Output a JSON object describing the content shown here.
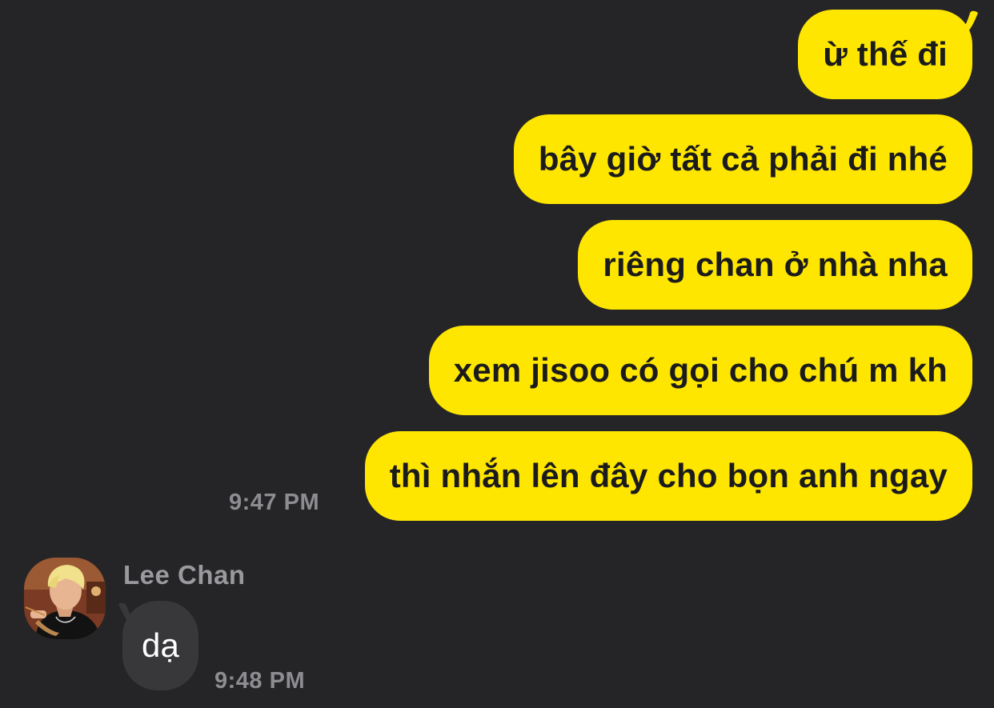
{
  "chat": {
    "outgoing": [
      {
        "text": "ừ thế đi"
      },
      {
        "text": "bây giờ tất cả phải đi nhé"
      },
      {
        "text": "riêng chan ở nhà nha"
      },
      {
        "text": "xem jisoo có gọi cho chú m kh"
      },
      {
        "text": "thì nhắn lên đây cho bọn anh ngay"
      }
    ],
    "outgoing_time": "9:47 PM",
    "incoming": {
      "sender": "Lee Chan",
      "avatar_icon": "profile-photo-avatar",
      "messages": [
        {
          "text": "dạ"
        }
      ],
      "time": "9:48 PM"
    },
    "colors": {
      "background": "#252527",
      "outgoing_bubble": "#ffe600",
      "incoming_bubble": "#38383b",
      "timestamp": "#8d8d91"
    }
  }
}
